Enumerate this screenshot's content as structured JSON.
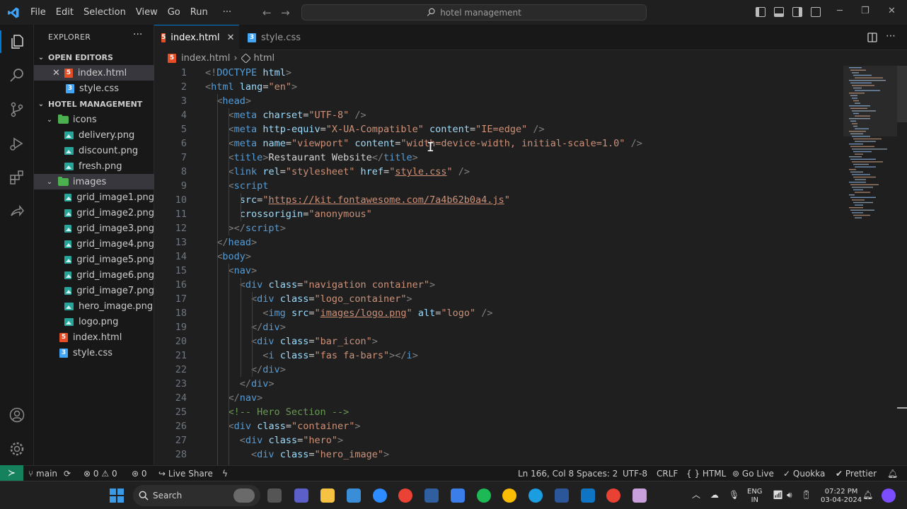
{
  "titlebar": {
    "menu": [
      "File",
      "Edit",
      "Selection",
      "View",
      "Go",
      "Run",
      "···"
    ],
    "search_text": "hotel management"
  },
  "sidebar": {
    "title": "EXPLORER",
    "more": "···",
    "open_editors_label": "OPEN EDITORS",
    "open_editors": [
      {
        "name": "index.html",
        "type": "html",
        "selected": true
      },
      {
        "name": "style.css",
        "type": "css"
      }
    ],
    "project_label": "HOTEL MANAGEMENT",
    "tree": [
      {
        "name": "icons",
        "type": "folder",
        "depth": 1
      },
      {
        "name": "delivery.png",
        "type": "png",
        "depth": 2
      },
      {
        "name": "discount.png",
        "type": "png",
        "depth": 2
      },
      {
        "name": "fresh.png",
        "type": "png",
        "depth": 2
      },
      {
        "name": "images",
        "type": "folder",
        "depth": 1,
        "selected": true
      },
      {
        "name": "grid_image1.png",
        "type": "png",
        "depth": 2
      },
      {
        "name": "grid_image2.png",
        "type": "png",
        "depth": 2
      },
      {
        "name": "grid_image3.png",
        "type": "png",
        "depth": 2
      },
      {
        "name": "grid_image4.png",
        "type": "png",
        "depth": 2
      },
      {
        "name": "grid_image5.png",
        "type": "png",
        "depth": 2
      },
      {
        "name": "grid_image6.png",
        "type": "png",
        "depth": 2
      },
      {
        "name": "grid_image7.png",
        "type": "png",
        "depth": 2
      },
      {
        "name": "hero_image.png",
        "type": "png",
        "depth": 2
      },
      {
        "name": "logo.png",
        "type": "png",
        "depth": 2
      },
      {
        "name": "index.html",
        "type": "html",
        "depth": 1
      },
      {
        "name": "style.css",
        "type": "css",
        "depth": 1
      }
    ]
  },
  "tabs": [
    {
      "label": "index.html",
      "active": true,
      "type": "html"
    },
    {
      "label": "style.css",
      "active": false,
      "type": "css"
    }
  ],
  "breadcrumb": {
    "file": "index.html",
    "symbol": "html"
  },
  "editor": {
    "line_numbers": [
      "1",
      "2",
      "3",
      "4",
      "5",
      "6",
      "7",
      "8",
      "9",
      "10",
      "11",
      "12",
      "13",
      "14",
      "15",
      "16",
      "17",
      "18",
      "19",
      "20",
      "21",
      "22",
      "23",
      "24",
      "25",
      "26",
      "27",
      "28"
    ],
    "lines": [
      {
        "indent": "",
        "html": "<span class='t-br'>&lt;!</span><span class='t-tag'>DOCTYPE</span> <span class='t-at'>html</span><span class='t-br'>&gt;</span>"
      },
      {
        "indent": "",
        "html": "<span class='t-br'>&lt;</span><span class='t-tag'>html</span> <span class='t-at'>lang</span>=<span class='t-str'>\"en\"</span><span class='t-br'>&gt;</span>"
      },
      {
        "indent": "  ",
        "html": "<span class='t-br'>&lt;</span><span class='t-tag'>head</span><span class='t-br'>&gt;</span>"
      },
      {
        "indent": "    ",
        "html": "<span class='t-br'>&lt;</span><span class='t-tag'>meta</span> <span class='t-at'>charset</span>=<span class='t-str'>\"UTF-8\"</span> <span class='t-br'>/&gt;</span>"
      },
      {
        "indent": "    ",
        "html": "<span class='t-br'>&lt;</span><span class='t-tag'>meta</span> <span class='t-at'>http-equiv</span>=<span class='t-str'>\"X-UA-Compatible\"</span> <span class='t-at'>content</span>=<span class='t-str'>\"IE=edge\"</span> <span class='t-br'>/&gt;</span>"
      },
      {
        "indent": "    ",
        "html": "<span class='t-br'>&lt;</span><span class='t-tag'>meta</span> <span class='t-at'>name</span>=<span class='t-str'>\"viewport\"</span> <span class='t-at'>content</span>=<span class='t-str'>\"width=device-width, initial-scale=1.0\"</span> <span class='t-br'>/&gt;</span>"
      },
      {
        "indent": "    ",
        "html": "<span class='t-br'>&lt;</span><span class='t-tag'>title</span><span class='t-br'>&gt;</span><span class='t-txt'>Restaurant Website</span><span class='t-br'>&lt;/</span><span class='t-tag'>title</span><span class='t-br'>&gt;</span>"
      },
      {
        "indent": "    ",
        "html": "<span class='t-br'>&lt;</span><span class='t-tag'>link</span> <span class='t-at'>rel</span>=<span class='t-str'>\"stylesheet\"</span> <span class='t-at'>href</span>=<span class='t-str'>\"<u>style.css</u>\"</span> <span class='t-br'>/&gt;</span>"
      },
      {
        "indent": "    ",
        "html": "<span class='t-br'>&lt;</span><span class='t-tag'>script</span>"
      },
      {
        "indent": "      ",
        "html": "<span class='t-at'>src</span>=<span class='t-str'>\"<u>https://kit.fontawesome.com/7a4b62b0a4.js</u>\"</span>"
      },
      {
        "indent": "      ",
        "html": "<span class='t-at'>crossorigin</span>=<span class='t-str'>\"anonymous\"</span>"
      },
      {
        "indent": "    ",
        "html": "<span class='t-br'>&gt;&lt;/</span><span class='t-tag'>script</span><span class='t-br'>&gt;</span>"
      },
      {
        "indent": "  ",
        "html": "<span class='t-br'>&lt;/</span><span class='t-tag'>head</span><span class='t-br'>&gt;</span>"
      },
      {
        "indent": "  ",
        "html": "<span class='t-br'>&lt;</span><span class='t-tag'>body</span><span class='t-br'>&gt;</span>"
      },
      {
        "indent": "    ",
        "html": "<span class='t-br'>&lt;</span><span class='t-tag'>nav</span><span class='t-br'>&gt;</span>"
      },
      {
        "indent": "      ",
        "html": "<span class='t-br'>&lt;</span><span class='t-tag'>div</span> <span class='t-at'>class</span>=<span class='t-str'>\"navigation container\"</span><span class='t-br'>&gt;</span>"
      },
      {
        "indent": "        ",
        "html": "<span class='t-br'>&lt;</span><span class='t-tag'>div</span> <span class='t-at'>class</span>=<span class='t-str'>\"logo_container\"</span><span class='t-br'>&gt;</span>"
      },
      {
        "indent": "          ",
        "html": "<span class='t-br'>&lt;</span><span class='t-tag'>img</span> <span class='t-at'>src</span>=<span class='t-str'>\"<u>images/logo.png</u>\"</span> <span class='t-at'>alt</span>=<span class='t-str'>\"logo\"</span> <span class='t-br'>/&gt;</span>"
      },
      {
        "indent": "        ",
        "html": "<span class='t-br'>&lt;/</span><span class='t-tag'>div</span><span class='t-br'>&gt;</span>"
      },
      {
        "indent": "        ",
        "html": "<span class='t-br'>&lt;</span><span class='t-tag'>div</span> <span class='t-at'>class</span>=<span class='t-str'>\"bar_icon\"</span><span class='t-br'>&gt;</span>"
      },
      {
        "indent": "          ",
        "html": "<span class='t-br'>&lt;</span><span class='t-tag'>i</span> <span class='t-at'>class</span>=<span class='t-str'>\"fas fa-bars\"</span><span class='t-br'>&gt;&lt;/</span><span class='t-tag'>i</span><span class='t-br'>&gt;</span>"
      },
      {
        "indent": "        ",
        "html": "<span class='t-br'>&lt;/</span><span class='t-tag'>div</span><span class='t-br'>&gt;</span>"
      },
      {
        "indent": "      ",
        "html": "<span class='t-br'>&lt;/</span><span class='t-tag'>div</span><span class='t-br'>&gt;</span>"
      },
      {
        "indent": "    ",
        "html": "<span class='t-br'>&lt;/</span><span class='t-tag'>nav</span><span class='t-br'>&gt;</span>"
      },
      {
        "indent": "    ",
        "html": "<span class='t-cm'>&lt;!-- Hero Section --&gt;</span>"
      },
      {
        "indent": "    ",
        "html": "<span class='t-br'>&lt;</span><span class='t-tag'>div</span> <span class='t-at'>class</span>=<span class='t-str'>\"container\"</span><span class='t-br'>&gt;</span>"
      },
      {
        "indent": "      ",
        "html": "<span class='t-br'>&lt;</span><span class='t-tag'>div</span> <span class='t-at'>class</span>=<span class='t-str'>\"hero\"</span><span class='t-br'>&gt;</span>"
      },
      {
        "indent": "        ",
        "html": "<span class='t-br'>&lt;</span><span class='t-tag'>div</span> <span class='t-at'>class</span>=<span class='t-str'>\"hero_image\"</span><span class='t-br'>&gt;</span>"
      }
    ]
  },
  "statusbar": {
    "branch": "main",
    "errors": "0",
    "warnings": "0",
    "ports": "0",
    "live_share": "Live Share",
    "position": "Ln 166, Col 8",
    "spaces": "Spaces: 2",
    "encoding": "UTF-8",
    "eol": "CRLF",
    "language": "HTML",
    "go_live": "Go Live",
    "quokka": "Quokka",
    "prettier": "Prettier"
  },
  "taskbar": {
    "search_placeholder": "Search",
    "lang1": "ENG",
    "lang2": "IN",
    "time": "07:22 PM",
    "date": "03-04-2024"
  },
  "colors": {
    "accent": "#0078d4",
    "remote": "#16825d",
    "html_icon": "#e44d26",
    "css_icon": "#42a5f5",
    "png_icon": "#26a69a",
    "folder_icon": "#4caf50"
  }
}
